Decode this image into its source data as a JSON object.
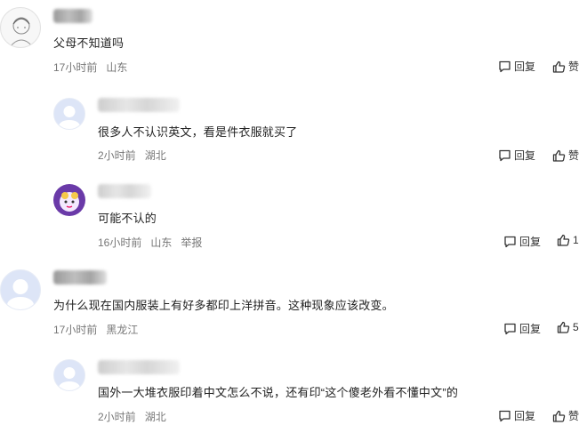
{
  "actions": {
    "reply": "回复",
    "like": "赞"
  },
  "comments": [
    {
      "text": "父母不知道吗",
      "time": "17小时前",
      "location": "山东"
    },
    {
      "text": "很多人不认识英文，看是件衣服就买了",
      "time": "2小时前",
      "location": "湖北"
    },
    {
      "text": "可能不认的",
      "time": "16小时前",
      "location": "山东",
      "report": "举报",
      "likes": "1"
    },
    {
      "text": "为什么现在国内服装上有好多都印上洋拼音。这种现象应该改变。",
      "time": "17小时前",
      "location": "黑龙江",
      "likes": "5"
    },
    {
      "text": "国外一大堆衣服印着中文怎么不说，还有印“这个傻老外看不懂中文”的",
      "time": "2小时前",
      "location": "湖北"
    }
  ],
  "colors": {
    "text": "#222222",
    "meta": "#777777",
    "avatar_bg": "#dde5f7"
  }
}
